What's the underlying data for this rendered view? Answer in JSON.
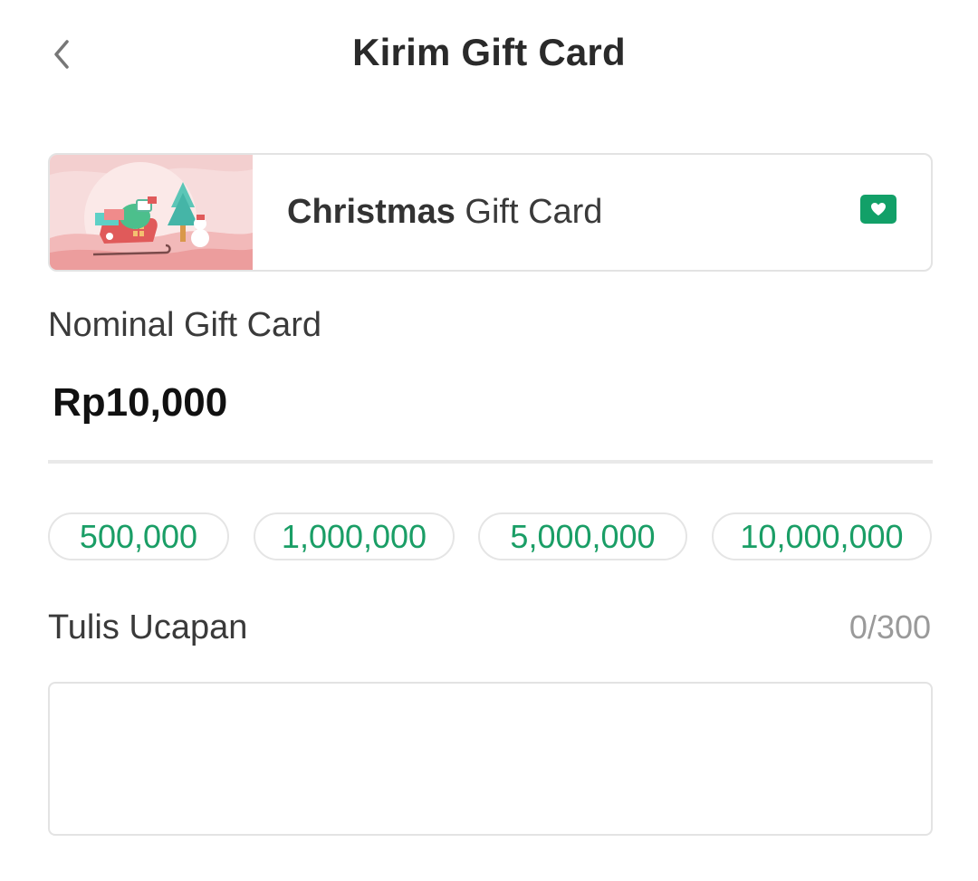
{
  "header": {
    "title": "Kirim Gift Card",
    "back_icon": "chevron-left-icon"
  },
  "gift_card": {
    "name_bold": "Christmas",
    "name_rest": " Gift Card",
    "badge_icon": "heart-icon",
    "badge_color": "#12a068"
  },
  "nominal": {
    "label": "Nominal Gift Card",
    "amount": "Rp10,000"
  },
  "chips": [
    {
      "label": "500,000"
    },
    {
      "label": "1,000,000"
    },
    {
      "label": "5,000,000"
    },
    {
      "label": "10,000,000"
    }
  ],
  "message": {
    "label": "Tulis Ucapan",
    "counter": "0/300",
    "value": "",
    "placeholder": ""
  },
  "colors": {
    "accent": "#1a9e66"
  }
}
